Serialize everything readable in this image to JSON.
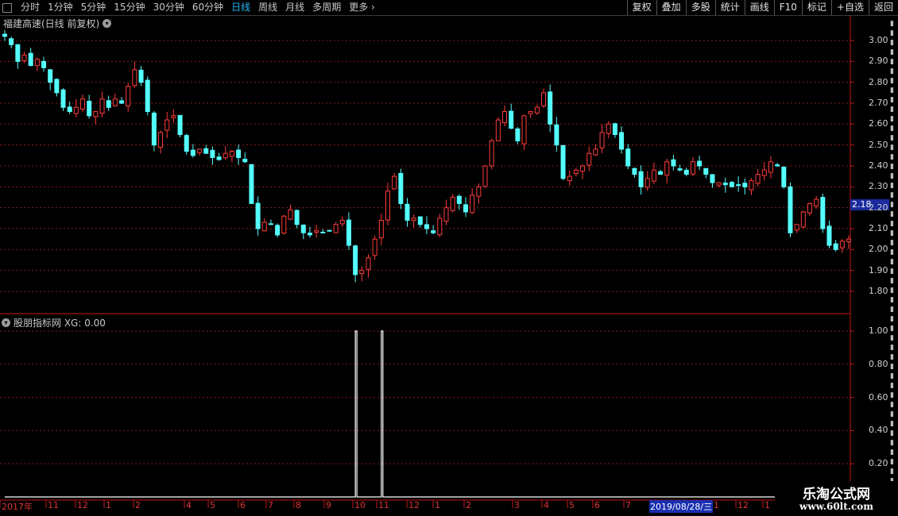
{
  "toolbar": {
    "periods": [
      "分时",
      "1分钟",
      "5分钟",
      "15分钟",
      "30分钟",
      "60分钟",
      "日线",
      "周线",
      "月线",
      "多周期",
      "更多"
    ],
    "active_period": "日线",
    "buttons": [
      "复权",
      "叠加",
      "多股",
      "统计",
      "画线",
      "F10",
      "标记",
      "+自选",
      "返回"
    ]
  },
  "main_chart": {
    "title": "福建高速(日线 前复权)",
    "current_price": "2.18",
    "y_ticks": [
      "3.00",
      "2.90",
      "2.80",
      "2.70",
      "2.60",
      "2.50",
      "2.40",
      "2.30",
      "2.20",
      "2.10",
      "2.00",
      "1.90",
      "1.80"
    ]
  },
  "indicator": {
    "title": "股朋指标网 XG: 0.00",
    "y_ticks": [
      "1.00",
      "0.80",
      "0.60",
      "0.40",
      "0.20"
    ]
  },
  "time_axis": {
    "labels": [
      "2017年",
      "11",
      "12",
      "1",
      "2",
      "4",
      "5",
      "6",
      "7",
      "8",
      "9",
      "10",
      "11",
      "12",
      "1",
      "2",
      "3",
      "4",
      "5",
      "6",
      "7",
      "8",
      "1",
      "12",
      "1"
    ],
    "highlight_date": "2019/08/28/三"
  },
  "watermark": {
    "line1": "乐淘公式网",
    "line2": "www.60lt.com"
  },
  "colors": {
    "up": "#ff3b3b",
    "down": "#54ffff",
    "grid": "#8b1a1a",
    "axis": "#c01818"
  },
  "chart_data": [
    {
      "type": "candlestick",
      "title": "福建高速(日线 前复权)",
      "ylim": [
        1.75,
        3.05
      ],
      "close_series": [
        3.02,
        2.98,
        2.9,
        2.93,
        2.88,
        2.91,
        2.87,
        2.8,
        2.75,
        2.68,
        2.66,
        2.68,
        2.72,
        2.64,
        2.66,
        2.72,
        2.68,
        2.72,
        2.7,
        2.78,
        2.86,
        2.8,
        2.66,
        2.5,
        2.56,
        2.62,
        2.64,
        2.55,
        2.47,
        2.45,
        2.48,
        2.46,
        2.44,
        2.43,
        2.46,
        2.47,
        2.44,
        2.42,
        2.22,
        2.1,
        2.13,
        2.12,
        2.07,
        2.16,
        2.19,
        2.12,
        2.08,
        2.07,
        2.09,
        2.08,
        2.09,
        2.12,
        2.14,
        2.02,
        1.88,
        1.9,
        1.96,
        2.05,
        2.14,
        2.28,
        2.35,
        2.22,
        2.14,
        2.15,
        2.12,
        2.1,
        2.08,
        2.15,
        2.2,
        2.25,
        2.22,
        2.18,
        2.26,
        2.3,
        2.4,
        2.52,
        2.62,
        2.66,
        2.58,
        2.52,
        2.64,
        2.66,
        2.68,
        2.75,
        2.6,
        2.5,
        2.34,
        2.35,
        2.38,
        2.4,
        2.46,
        2.48,
        2.56,
        2.6,
        2.55,
        2.48,
        2.4,
        2.36,
        2.3,
        2.34,
        2.38,
        2.36,
        2.42,
        2.4,
        2.38,
        2.36,
        2.42,
        2.4,
        2.36,
        2.32,
        2.32,
        2.31,
        2.3,
        2.31,
        2.3,
        2.33,
        2.36,
        2.38,
        2.42,
        2.4,
        2.3,
        2.08,
        2.12,
        2.18,
        2.22,
        2.24,
        2.1,
        2.02,
        2.0,
        2.04,
        2.05
      ]
    },
    {
      "type": "line",
      "title": "股朋指标网 XG",
      "ylim": [
        0,
        1
      ],
      "signal_indices": [
        54,
        58
      ],
      "values_note_current": 0.0
    }
  ]
}
